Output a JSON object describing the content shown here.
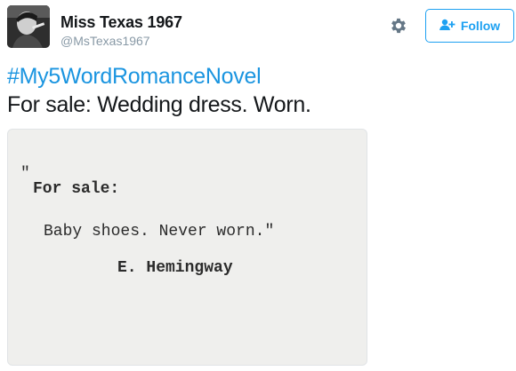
{
  "user": {
    "name": "Miss Texas 1967",
    "handle": "@MsTexas1967"
  },
  "actions": {
    "settings_icon": "gear-icon",
    "follow_icon": "add-user-icon",
    "follow_label": "Follow"
  },
  "tweet": {
    "hashtag": "#My5WordRomanceNovel",
    "text": "For sale: Wedding dress. Worn."
  },
  "image": {
    "open_quote": "\"",
    "line1": "For sale:",
    "line2": "Baby shoes. Never worn.\"",
    "signature": "E. Hemingway"
  },
  "colors": {
    "accent": "#1da1f2",
    "hashtag": "#1b95e0",
    "text": "#14171a",
    "muted": "#8899a6"
  }
}
